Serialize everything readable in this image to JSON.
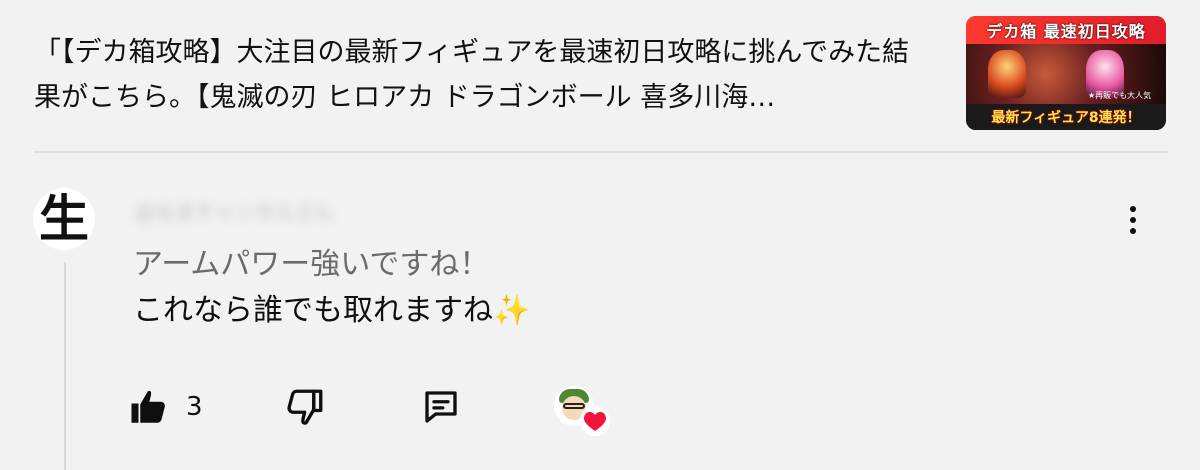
{
  "video": {
    "title": "「【デカ箱攻略】大注目の最新フィギュアを最速初日攻略に挑んでみた結果がこちら。【鬼滅の刃 ヒロアカ ドラゴンボール 喜多川海…",
    "thumbnail": {
      "top_text": "デカ箱 最速初日攻略",
      "small_text": "★再販でも大人気",
      "bottom_text": "最新フィギュア8連発！"
    }
  },
  "comment": {
    "avatar_glyph": "生",
    "author": "@なまチャンネルさん",
    "lines": [
      "アームパワー強いですね！",
      "これなら誰でも取れますね✨"
    ]
  },
  "actions": {
    "like_count": "3",
    "icons": {
      "like": "thumbs-up-icon",
      "dislike": "thumbs-down-icon",
      "reply": "reply-comment-icon",
      "more": "more-vertical-icon",
      "heart": "creator-heart-icon"
    }
  },
  "colors": {
    "background": "#f2f2f2",
    "text": "#0f0f0f",
    "muted_text": "#6b6b6b",
    "heart": "#f2143c",
    "divider": "#dedede"
  }
}
